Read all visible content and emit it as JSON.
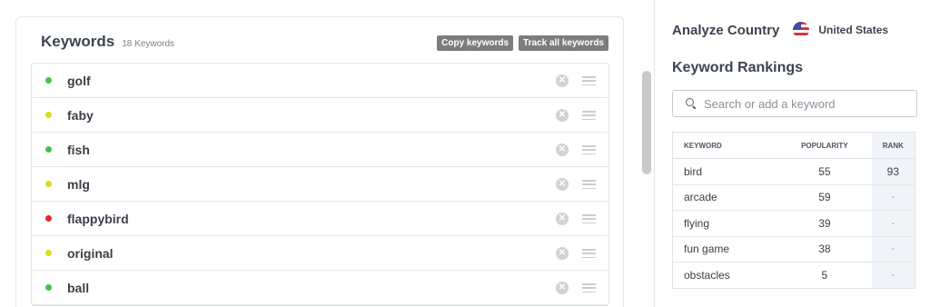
{
  "keywords_panel": {
    "title": "Keywords",
    "count_label": "18 Keywords",
    "copy_button": "Copy keywords",
    "track_button": "Track all keywords",
    "items": [
      {
        "label": "golf",
        "status_color": "#44c24a"
      },
      {
        "label": "faby",
        "status_color": "#d8dc1e"
      },
      {
        "label": "fish",
        "status_color": "#44c24a"
      },
      {
        "label": "mlg",
        "status_color": "#d8dc1e"
      },
      {
        "label": "flappybird",
        "status_color": "#e8252a"
      },
      {
        "label": "original",
        "status_color": "#d8dc1e"
      },
      {
        "label": "ball",
        "status_color": "#44c24a"
      }
    ]
  },
  "analyze": {
    "label": "Analyze Country",
    "country": "United States",
    "flag_icon": "us-flag-icon"
  },
  "rankings": {
    "title": "Keyword Rankings",
    "search_placeholder": "Search or add a keyword",
    "columns": [
      "KEYWORD",
      "POPULARITY",
      "RANK"
    ],
    "rows": [
      {
        "keyword": "bird",
        "popularity": "55",
        "rank": "93"
      },
      {
        "keyword": "arcade",
        "popularity": "59",
        "rank": "-"
      },
      {
        "keyword": "flying",
        "popularity": "39",
        "rank": "-"
      },
      {
        "keyword": "fun game",
        "popularity": "38",
        "rank": "-"
      },
      {
        "keyword": "obstacles",
        "popularity": "5",
        "rank": "-"
      }
    ]
  }
}
